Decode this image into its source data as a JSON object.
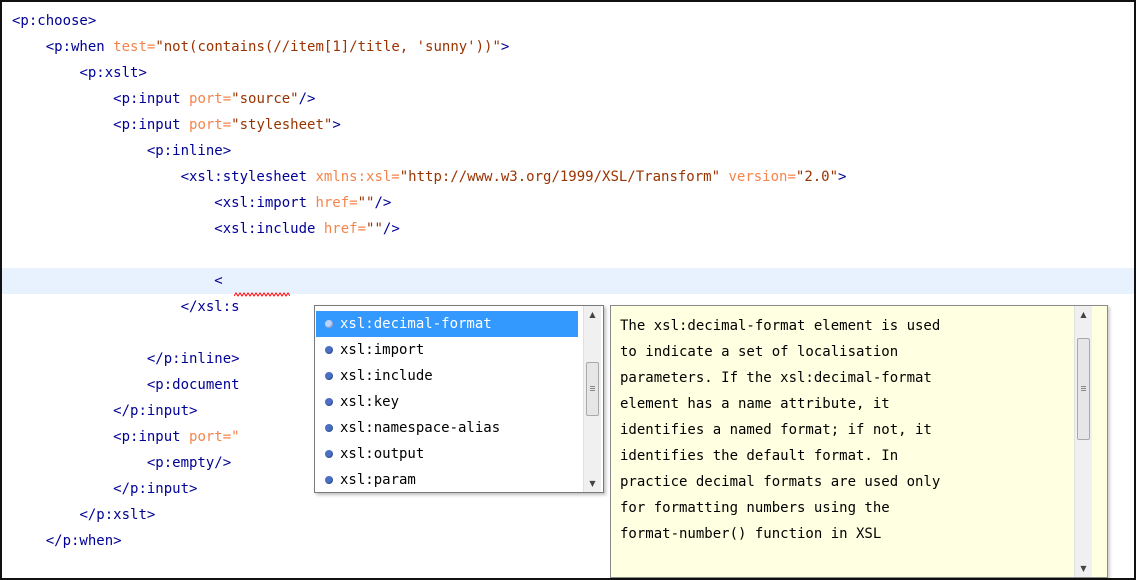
{
  "editor": {
    "lines": [
      [
        {
          "t": "tag",
          "v": "<p:choose>"
        }
      ],
      [
        {
          "t": "text",
          "v": "    "
        },
        {
          "t": "tag",
          "v": "<p:when "
        },
        {
          "t": "attr",
          "v": "test="
        },
        {
          "t": "val",
          "v": "\"not(contains(//item[1]/title, 'sunny'))\""
        },
        {
          "t": "tag",
          "v": ">"
        }
      ],
      [
        {
          "t": "text",
          "v": "        "
        },
        {
          "t": "tag",
          "v": "<p:xslt>"
        }
      ],
      [
        {
          "t": "text",
          "v": "            "
        },
        {
          "t": "tag",
          "v": "<p:input "
        },
        {
          "t": "attr",
          "v": "port="
        },
        {
          "t": "val",
          "v": "\"source\""
        },
        {
          "t": "tag",
          "v": "/>"
        }
      ],
      [
        {
          "t": "text",
          "v": "            "
        },
        {
          "t": "tag",
          "v": "<p:input "
        },
        {
          "t": "attr",
          "v": "port="
        },
        {
          "t": "val",
          "v": "\"stylesheet\""
        },
        {
          "t": "tag",
          "v": ">"
        }
      ],
      [
        {
          "t": "text",
          "v": "                "
        },
        {
          "t": "tag",
          "v": "<p:inline>"
        }
      ],
      [
        {
          "t": "text",
          "v": "                    "
        },
        {
          "t": "tag",
          "v": "<xsl:stylesheet "
        },
        {
          "t": "attr",
          "v": "xmlns:xsl="
        },
        {
          "t": "val",
          "v": "\"http://www.w3.org/1999/XSL/Transform\""
        },
        {
          "t": "attr",
          "v": " version="
        },
        {
          "t": "val",
          "v": "\"2.0\""
        },
        {
          "t": "tag",
          "v": ">"
        }
      ],
      [
        {
          "t": "text",
          "v": "                        "
        },
        {
          "t": "tag",
          "v": "<xsl:import "
        },
        {
          "t": "attr",
          "v": "href="
        },
        {
          "t": "val",
          "v": "\"\""
        },
        {
          "t": "tag",
          "v": "/>"
        }
      ],
      [
        {
          "t": "text",
          "v": "                        "
        },
        {
          "t": "tag",
          "v": "<xsl:include "
        },
        {
          "t": "attr",
          "v": "href="
        },
        {
          "t": "val",
          "v": "\"\""
        },
        {
          "t": "tag",
          "v": "/>"
        }
      ],
      [],
      [
        {
          "t": "text",
          "v": "                        "
        },
        {
          "t": "tag",
          "v": "<"
        }
      ],
      [
        {
          "t": "text",
          "v": "                    "
        },
        {
          "t": "tag",
          "v": "</xsl:s"
        }
      ],
      [],
      [
        {
          "t": "text",
          "v": "                "
        },
        {
          "t": "tag",
          "v": "</p:inline>"
        }
      ],
      [
        {
          "t": "text",
          "v": "                "
        },
        {
          "t": "tag",
          "v": "<p:document"
        }
      ],
      [
        {
          "t": "text",
          "v": "            "
        },
        {
          "t": "tag",
          "v": "</p:input>"
        }
      ],
      [
        {
          "t": "text",
          "v": "            "
        },
        {
          "t": "tag",
          "v": "<p:input "
        },
        {
          "t": "attr",
          "v": "port=\""
        }
      ],
      [
        {
          "t": "text",
          "v": "                "
        },
        {
          "t": "tag",
          "v": "<p:empty/>"
        }
      ],
      [
        {
          "t": "text",
          "v": "            "
        },
        {
          "t": "tag",
          "v": "</p:input>"
        }
      ],
      [
        {
          "t": "text",
          "v": "        "
        },
        {
          "t": "tag",
          "v": "</p:xslt>"
        }
      ],
      [
        {
          "t": "text",
          "v": "    "
        },
        {
          "t": "tag",
          "v": "</p:when>"
        }
      ]
    ]
  },
  "completion": {
    "items": [
      "xsl:decimal-format",
      "xsl:import",
      "xsl:include",
      "xsl:key",
      "xsl:namespace-alias",
      "xsl:output",
      "xsl:param"
    ],
    "selected_index": 0,
    "scroll": {
      "up_icon": "▲",
      "down_icon": "▼"
    }
  },
  "doc": {
    "lines": [
      "The xsl:decimal-format element is used",
      "to indicate a set of localisation",
      "parameters. If the xsl:decimal-format",
      "element has a name attribute, it",
      "identifies a named format; if not, it",
      "identifies the default format. In",
      "practice decimal formats are used only",
      "for formatting numbers using the",
      "format-number() function in XSL"
    ],
    "scroll": {
      "up_icon": "▲",
      "down_icon": "▼"
    }
  },
  "colors": {
    "tag": "#000096",
    "attribute": "#f5844c",
    "value": "#993300",
    "current_line": "#e8f2fe",
    "selection": "#3399ff",
    "doc_background": "#ffffe1",
    "squiggle": "#ff0000"
  }
}
